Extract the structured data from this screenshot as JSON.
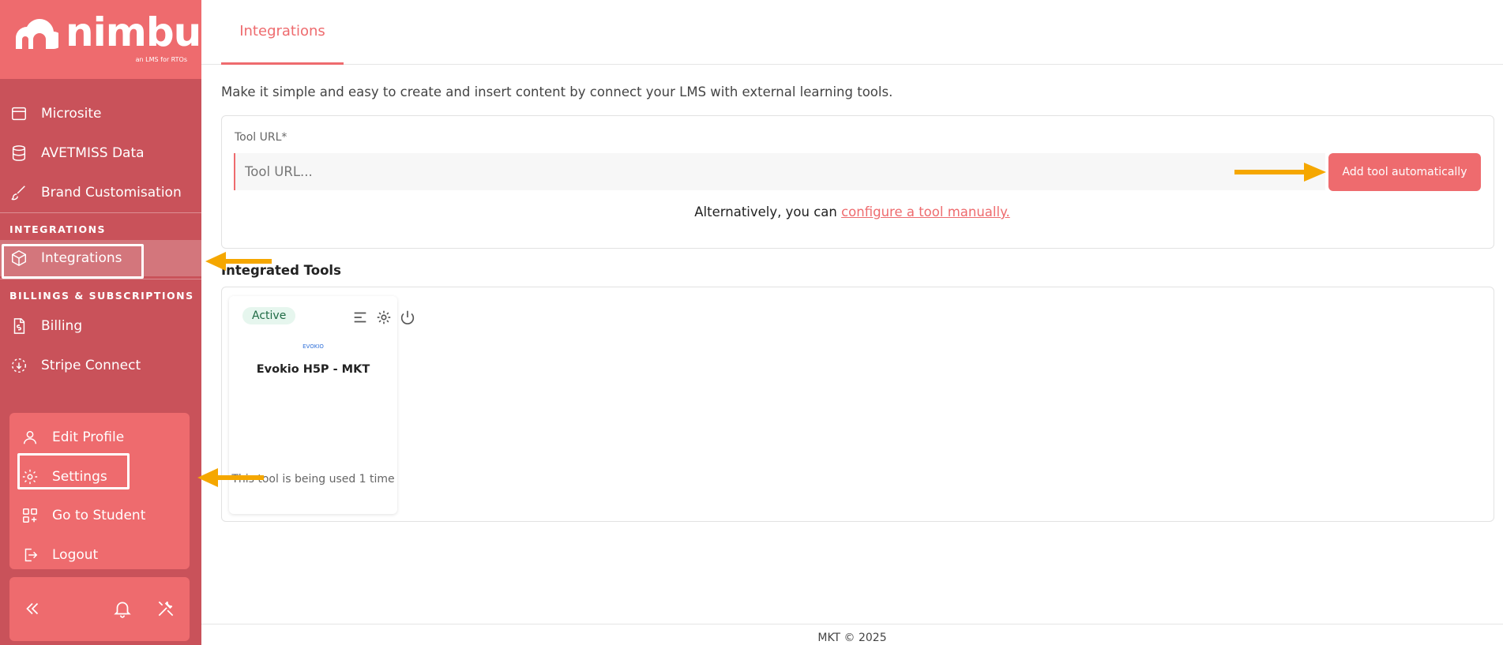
{
  "brand": {
    "name": "nimbu",
    "tagline": "an LMS for RTOs"
  },
  "sidebar": {
    "items": [
      {
        "label": "Microsite",
        "icon": "window-icon"
      },
      {
        "label": "AVETMISS Data",
        "icon": "database-icon"
      },
      {
        "label": "Brand Customisation",
        "icon": "brush-icon"
      }
    ],
    "integrations_section": "INTEGRATIONS",
    "integrations_item": {
      "label": "Integrations",
      "icon": "cube-icon"
    },
    "billing_section": "BILLINGS & SUBSCRIPTIONS",
    "billing_items": [
      {
        "label": "Billing",
        "icon": "invoice-icon"
      },
      {
        "label": "Stripe Connect",
        "icon": "dashed-circle-icon"
      }
    ],
    "profile_menu": [
      {
        "label": "Edit Profile",
        "icon": "user-icon"
      },
      {
        "label": "Settings",
        "icon": "gear-icon"
      },
      {
        "label": "Go to Student",
        "icon": "grid-plus-icon"
      },
      {
        "label": "Logout",
        "icon": "logout-icon"
      }
    ]
  },
  "tabs": {
    "active": "Integrations"
  },
  "main": {
    "intro": "Make it simple and easy to create and insert content by connect your LMS with external learning tools.",
    "tool_url_label": "Tool URL*",
    "tool_url_placeholder": "Tool URL...",
    "add_button": "Add tool automatically",
    "alt_prefix": "Alternatively, you can ",
    "alt_link": "configure a tool manually.",
    "integrated_title": "Integrated Tools"
  },
  "tool_card": {
    "status": "Active",
    "logo_text": "EVOKIO",
    "name": "Evokio H5P - MKT",
    "usage": "This tool is being used 1 time"
  },
  "footer": {
    "text": "MKT © 2025"
  },
  "colors": {
    "accent": "#ee6b6e",
    "sidebar": "#c9525a",
    "annotation_arrow": "#f5a700"
  }
}
